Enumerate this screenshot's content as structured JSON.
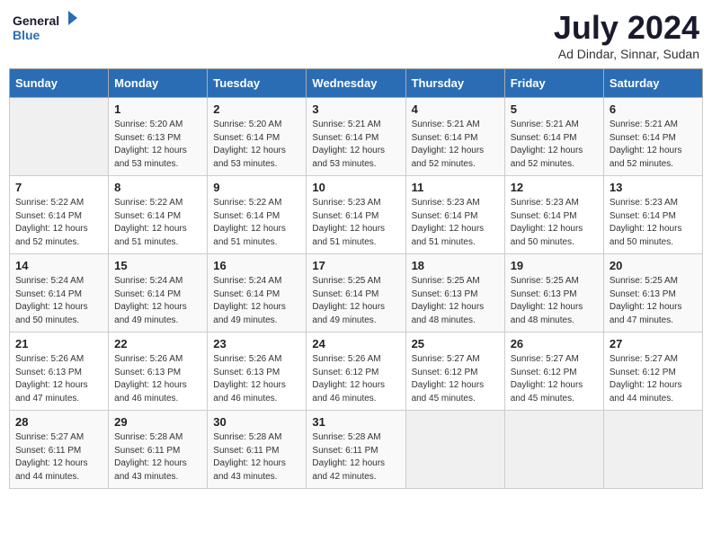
{
  "header": {
    "logo_line1": "General",
    "logo_line2": "Blue",
    "month_year": "July 2024",
    "location": "Ad Dindar, Sinnar, Sudan"
  },
  "days_of_week": [
    "Sunday",
    "Monday",
    "Tuesday",
    "Wednesday",
    "Thursday",
    "Friday",
    "Saturday"
  ],
  "weeks": [
    {
      "days": [
        {
          "num": "",
          "empty": true
        },
        {
          "num": "1",
          "sunrise": "5:20 AM",
          "sunset": "6:13 PM",
          "daylight": "12 hours and 53 minutes."
        },
        {
          "num": "2",
          "sunrise": "5:20 AM",
          "sunset": "6:14 PM",
          "daylight": "12 hours and 53 minutes."
        },
        {
          "num": "3",
          "sunrise": "5:21 AM",
          "sunset": "6:14 PM",
          "daylight": "12 hours and 53 minutes."
        },
        {
          "num": "4",
          "sunrise": "5:21 AM",
          "sunset": "6:14 PM",
          "daylight": "12 hours and 52 minutes."
        },
        {
          "num": "5",
          "sunrise": "5:21 AM",
          "sunset": "6:14 PM",
          "daylight": "12 hours and 52 minutes."
        },
        {
          "num": "6",
          "sunrise": "5:21 AM",
          "sunset": "6:14 PM",
          "daylight": "12 hours and 52 minutes."
        }
      ]
    },
    {
      "days": [
        {
          "num": "7",
          "sunrise": "5:22 AM",
          "sunset": "6:14 PM",
          "daylight": "12 hours and 52 minutes."
        },
        {
          "num": "8",
          "sunrise": "5:22 AM",
          "sunset": "6:14 PM",
          "daylight": "12 hours and 51 minutes."
        },
        {
          "num": "9",
          "sunrise": "5:22 AM",
          "sunset": "6:14 PM",
          "daylight": "12 hours and 51 minutes."
        },
        {
          "num": "10",
          "sunrise": "5:23 AM",
          "sunset": "6:14 PM",
          "daylight": "12 hours and 51 minutes."
        },
        {
          "num": "11",
          "sunrise": "5:23 AM",
          "sunset": "6:14 PM",
          "daylight": "12 hours and 51 minutes."
        },
        {
          "num": "12",
          "sunrise": "5:23 AM",
          "sunset": "6:14 PM",
          "daylight": "12 hours and 50 minutes."
        },
        {
          "num": "13",
          "sunrise": "5:23 AM",
          "sunset": "6:14 PM",
          "daylight": "12 hours and 50 minutes."
        }
      ]
    },
    {
      "days": [
        {
          "num": "14",
          "sunrise": "5:24 AM",
          "sunset": "6:14 PM",
          "daylight": "12 hours and 50 minutes."
        },
        {
          "num": "15",
          "sunrise": "5:24 AM",
          "sunset": "6:14 PM",
          "daylight": "12 hours and 49 minutes."
        },
        {
          "num": "16",
          "sunrise": "5:24 AM",
          "sunset": "6:14 PM",
          "daylight": "12 hours and 49 minutes."
        },
        {
          "num": "17",
          "sunrise": "5:25 AM",
          "sunset": "6:14 PM",
          "daylight": "12 hours and 49 minutes."
        },
        {
          "num": "18",
          "sunrise": "5:25 AM",
          "sunset": "6:13 PM",
          "daylight": "12 hours and 48 minutes."
        },
        {
          "num": "19",
          "sunrise": "5:25 AM",
          "sunset": "6:13 PM",
          "daylight": "12 hours and 48 minutes."
        },
        {
          "num": "20",
          "sunrise": "5:25 AM",
          "sunset": "6:13 PM",
          "daylight": "12 hours and 47 minutes."
        }
      ]
    },
    {
      "days": [
        {
          "num": "21",
          "sunrise": "5:26 AM",
          "sunset": "6:13 PM",
          "daylight": "12 hours and 47 minutes."
        },
        {
          "num": "22",
          "sunrise": "5:26 AM",
          "sunset": "6:13 PM",
          "daylight": "12 hours and 46 minutes."
        },
        {
          "num": "23",
          "sunrise": "5:26 AM",
          "sunset": "6:13 PM",
          "daylight": "12 hours and 46 minutes."
        },
        {
          "num": "24",
          "sunrise": "5:26 AM",
          "sunset": "6:12 PM",
          "daylight": "12 hours and 46 minutes."
        },
        {
          "num": "25",
          "sunrise": "5:27 AM",
          "sunset": "6:12 PM",
          "daylight": "12 hours and 45 minutes."
        },
        {
          "num": "26",
          "sunrise": "5:27 AM",
          "sunset": "6:12 PM",
          "daylight": "12 hours and 45 minutes."
        },
        {
          "num": "27",
          "sunrise": "5:27 AM",
          "sunset": "6:12 PM",
          "daylight": "12 hours and 44 minutes."
        }
      ]
    },
    {
      "days": [
        {
          "num": "28",
          "sunrise": "5:27 AM",
          "sunset": "6:11 PM",
          "daylight": "12 hours and 44 minutes."
        },
        {
          "num": "29",
          "sunrise": "5:28 AM",
          "sunset": "6:11 PM",
          "daylight": "12 hours and 43 minutes."
        },
        {
          "num": "30",
          "sunrise": "5:28 AM",
          "sunset": "6:11 PM",
          "daylight": "12 hours and 43 minutes."
        },
        {
          "num": "31",
          "sunrise": "5:28 AM",
          "sunset": "6:11 PM",
          "daylight": "12 hours and 42 minutes."
        },
        {
          "num": "",
          "empty": true
        },
        {
          "num": "",
          "empty": true
        },
        {
          "num": "",
          "empty": true
        }
      ]
    }
  ]
}
